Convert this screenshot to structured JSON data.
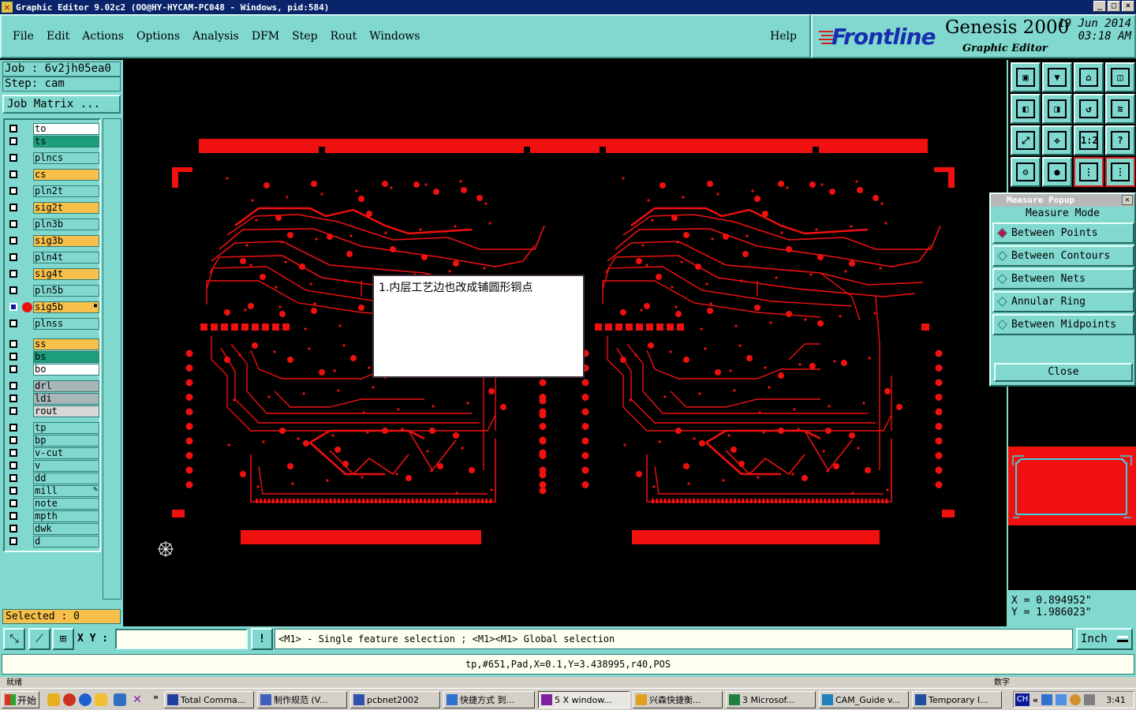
{
  "window": {
    "title": "Graphic Editor 9.02c2 (OO@HY-HYCAM-PC048 - Windows, pid:584)",
    "controls": [
      "_",
      "□",
      "×"
    ]
  },
  "menu": {
    "items": [
      "File",
      "Edit",
      "Actions",
      "Options",
      "Analysis",
      "DFM",
      "Step",
      "Rout",
      "Windows"
    ],
    "help": "Help"
  },
  "brand": {
    "logo": "Frontline",
    "product": "Genesis 2000",
    "subtitle": "Graphic Editor",
    "date": "19 Jun 2014",
    "time": "03:18 AM"
  },
  "job": {
    "job_label": "Job : 6v2jh05ea0",
    "step_label": "Step: cam",
    "matrix_button": "Job Matrix ..."
  },
  "layers": [
    {
      "name": "to",
      "color": "white"
    },
    {
      "name": "ts",
      "color": "green"
    },
    {
      "name": "plncs",
      "color": "cyan"
    },
    {
      "name": "cs",
      "color": "orange"
    },
    {
      "name": "pln2t",
      "color": "cyan"
    },
    {
      "name": "sig2t",
      "color": "orange"
    },
    {
      "name": "pln3b",
      "color": "cyan"
    },
    {
      "name": "sig3b",
      "color": "orange"
    },
    {
      "name": "pln4t",
      "color": "cyan"
    },
    {
      "name": "sig4t",
      "color": "orange"
    },
    {
      "name": "pln5b",
      "color": "cyan"
    },
    {
      "name": "sig5b",
      "color": "sel"
    },
    {
      "name": "plnss",
      "color": "cyan"
    },
    {
      "name": "ss",
      "color": "orange"
    },
    {
      "name": "bs",
      "color": "green"
    },
    {
      "name": "bo",
      "color": "white"
    },
    {
      "name": "drl",
      "color": "grey"
    },
    {
      "name": "ldi",
      "color": "grey"
    },
    {
      "name": "rout",
      "color": "lgrey"
    },
    {
      "name": "tp",
      "color": "cyan"
    },
    {
      "name": "bp",
      "color": "cyan"
    },
    {
      "name": "v-cut",
      "color": "cyan"
    },
    {
      "name": "v",
      "color": "cyan"
    },
    {
      "name": "dd",
      "color": "cyan"
    },
    {
      "name": "mill",
      "color": "cyan"
    },
    {
      "name": "note",
      "color": "cyan"
    },
    {
      "name": "mpth",
      "color": "cyan"
    },
    {
      "name": "dwk",
      "color": "cyan"
    },
    {
      "name": "d",
      "color": "cyan"
    }
  ],
  "selected": "Selected : 0",
  "note_text": "1.内层工艺边也改成铺圆形铜点",
  "measure": {
    "title": "Measure Popup",
    "mode_label": "Measure Mode",
    "options": [
      "Between Points",
      "Between Contours",
      "Between Nets",
      "Annular Ring",
      "Between Midpoints"
    ],
    "selected": "Between Points",
    "close": "Close"
  },
  "toolbar_icons": [
    "zoom-home-icon",
    "zoom-in-icon",
    "home-icon",
    "window-icon",
    "pan-left-icon",
    "pan-right-icon",
    "redraw-icon",
    "snap-icon",
    "fit-icon",
    "center-icon",
    "scale-icon",
    "help-icon",
    "settings-icon",
    "feature-icon",
    "net-icon",
    "layers-icon"
  ],
  "toolbar_labels": {
    "scale": "1:2",
    "help": "?"
  },
  "coords": {
    "x": "X = 0.894952\"",
    "y": "Y = 1.986023\""
  },
  "command": {
    "xy_label": "X Y :",
    "xy_value": "",
    "alert": "!",
    "hint": "<M1> - Single feature selection ; <M1><M1> Global selection",
    "unit": "Inch"
  },
  "status": "tp,#651,Pad,X=0.1,Y=3.438995,r40,POS",
  "strip": {
    "left": "就绪",
    "right": "数字"
  },
  "taskbar": {
    "start": "开始",
    "tasks": [
      {
        "label": "Total Comma...",
        "active": false
      },
      {
        "label": "制作规范 (V...",
        "active": false
      },
      {
        "label": "pcbnet2002",
        "active": false
      },
      {
        "label": "快捷方式 到...",
        "active": false
      },
      {
        "label": "5 X window...",
        "active": true
      },
      {
        "label": "兴森快捷衡...",
        "active": false
      },
      {
        "label": "3 Microsof...",
        "active": false
      },
      {
        "label": "CAM_Guide v...",
        "active": false
      },
      {
        "label": "Temporary I...",
        "active": false
      }
    ],
    "lang": "CH",
    "clock": "3:41"
  },
  "colors": {
    "accent": "#80d8cf",
    "copper": "#f01010",
    "selected_layer": "#f7c04a",
    "title": "#0a246a"
  }
}
